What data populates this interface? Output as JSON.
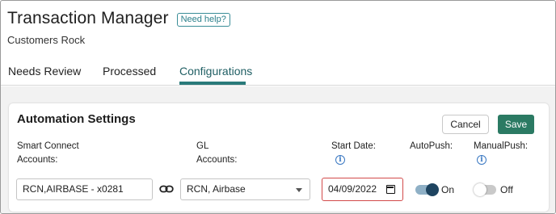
{
  "header": {
    "title": "Transaction Manager",
    "help_label": "Need help?",
    "subtitle": "Customers Rock"
  },
  "tabs": [
    {
      "label": "Needs Review",
      "active": false
    },
    {
      "label": "Processed",
      "active": false
    },
    {
      "label": "Configurations",
      "active": true
    }
  ],
  "settings": {
    "title": "Automation Settings",
    "cancel_label": "Cancel",
    "save_label": "Save",
    "columns": {
      "smart_connect": "Smart Connect Accounts:",
      "gl": "GL Accounts:",
      "start_date": "Start Date:",
      "autopush": "AutoPush:",
      "manualpush": "ManualPush:"
    },
    "row": {
      "smart_connect_value": "RCN,AIRBASE - x0281",
      "gl_value": "RCN, Airbase",
      "start_date_value": "04/09/2022",
      "autopush_state": "On",
      "autopush_on": true,
      "manualpush_state": "Off",
      "manualpush_on": false
    }
  },
  "colors": {
    "accent": "#2a7a7a",
    "save_button": "#2b7a63",
    "info_icon": "#3a78c2",
    "date_border": "#d24a4a",
    "toggle_on_knob": "#1e4460"
  },
  "icons": {
    "link": "link-icon",
    "info": "info-icon",
    "calendar": "calendar-icon",
    "dropdown": "chevron-down-icon"
  }
}
